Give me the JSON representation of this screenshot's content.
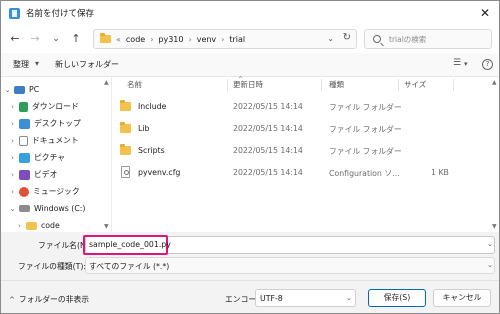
{
  "window": {
    "title": "名前を付けて保存",
    "close_glyph": "✕"
  },
  "nav_buttons": {
    "back": "←",
    "forward": "→",
    "down": "⌄",
    "up": "↑"
  },
  "address": {
    "root_sep": "«",
    "crumbs": [
      "code",
      "py310",
      "venv",
      "trial"
    ],
    "sep": "›"
  },
  "search": {
    "placeholder": "trialの検索"
  },
  "toolbar": {
    "organize": "整理",
    "organize_caret": "▾",
    "new_folder": "新しいフォルダー",
    "view_icon": "☰",
    "help_icon": "?"
  },
  "nav_pane": {
    "items": [
      {
        "label": "PC",
        "expanded": true,
        "icon_color": "#3c7fc4"
      },
      {
        "label": "ダウンロード",
        "expanded": false,
        "icon_color": "#2f9e5b"
      },
      {
        "label": "デスクトップ",
        "expanded": false,
        "icon_color": "#3a8fd6"
      },
      {
        "label": "ドキュメント",
        "expanded": false,
        "icon_color": "#8a8a8a"
      },
      {
        "label": "ピクチャ",
        "expanded": false,
        "icon_color": "#3aa0d9"
      },
      {
        "label": "ビデオ",
        "expanded": false,
        "icon_color": "#7c4dbd"
      },
      {
        "label": "ミュージック",
        "expanded": false,
        "icon_color": "#e0533a"
      },
      {
        "label": "Windows (C:)",
        "expanded": true,
        "icon_color": "#8c8c8c"
      },
      {
        "label": "code",
        "expanded": false,
        "icon_color": "#f2c14e"
      }
    ]
  },
  "columns": {
    "name": "名前",
    "date": "更新日時",
    "type": "種類",
    "size": "サイズ"
  },
  "files": [
    {
      "name": "Include",
      "date": "2022/05/15 14:14",
      "type": "ファイル フォルダー",
      "size": "",
      "kind": "folder"
    },
    {
      "name": "Lib",
      "date": "2022/05/15 14:14",
      "type": "ファイル フォルダー",
      "size": "",
      "kind": "folder"
    },
    {
      "name": "Scripts",
      "date": "2022/05/15 14:14",
      "type": "ファイル フォルダー",
      "size": "",
      "kind": "folder"
    },
    {
      "name": "pyvenv.cfg",
      "date": "2022/05/15 14:14",
      "type": "Configuration ソ...",
      "size": "1 KB",
      "kind": "file"
    }
  ],
  "file_name": {
    "label": "ファイル名(N):",
    "value": "sample_code_001.py"
  },
  "file_type": {
    "label": "ファイルの種類(T):",
    "value": "すべてのファイル (*.*)"
  },
  "footer": {
    "hide_folders": "フォルダーの非表示",
    "encoding_label": "エンコード:",
    "encoding_value": "UTF-8",
    "save": "保存(S)",
    "cancel": "キャンセル"
  },
  "colors": {
    "highlight": "#e0157a",
    "accent": "#0067c0"
  }
}
